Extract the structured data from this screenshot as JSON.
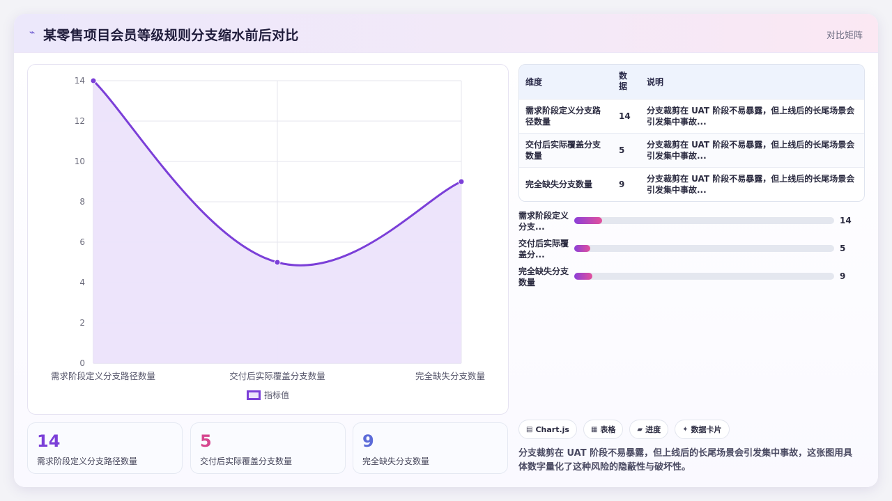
{
  "header": {
    "icon": "lightning-icon",
    "title": "某零售项目会员等级规则分支缩水前后对比",
    "tag": "对比矩阵"
  },
  "chart_data": {
    "type": "line",
    "categories": [
      "需求阶段定义分支路径数量",
      "交付后实际覆盖分支数量",
      "完全缺失分支数量"
    ],
    "series": [
      {
        "name": "指标值",
        "values": [
          14,
          5,
          9
        ]
      }
    ],
    "ylim": [
      0,
      14
    ],
    "yticks": [
      0,
      2,
      4,
      6,
      8,
      10,
      12,
      14
    ],
    "grid": true,
    "legend": "bottom",
    "line_color": "#7b3fd8",
    "fill_color": "#ece3fb"
  },
  "stats": [
    {
      "value": "14",
      "caption": "需求阶段定义分支路径数量",
      "color": "#7b3fd8"
    },
    {
      "value": "5",
      "caption": "交付后实际覆盖分支数量",
      "color": "#d6478f"
    },
    {
      "value": "9",
      "caption": "完全缺失分支数量",
      "color": "#5c6bd8"
    }
  ],
  "table": {
    "headers": [
      "维度",
      "数据",
      "说明"
    ],
    "rows": [
      {
        "dim": "需求阶段定义分支路径数量",
        "value": "14",
        "note": "分支裁剪在 UAT 阶段不易暴露，但上线后的长尾场景会引发集中事故..."
      },
      {
        "dim": "交付后实际覆盖分支数量",
        "value": "5",
        "note": "分支裁剪在 UAT 阶段不易暴露，但上线后的长尾场景会引发集中事故..."
      },
      {
        "dim": "完全缺失分支数量",
        "value": "9",
        "note": "分支裁剪在 UAT 阶段不易暴露，但上线后的长尾场景会引发集中事故..."
      }
    ]
  },
  "bars": [
    {
      "label": "需求阶段定义分支...",
      "value": 14,
      "display": "14",
      "fraction": 0.107
    },
    {
      "label": "交付后实际覆盖分...",
      "value": 5,
      "display": "5",
      "fraction": 0.062
    },
    {
      "label": "完全缺失分支数量",
      "value": 9,
      "display": "9",
      "fraction": 0.07
    }
  ],
  "chips": [
    {
      "icon": "chart-icon",
      "label": "Chart.js"
    },
    {
      "icon": "table-icon",
      "label": "表格"
    },
    {
      "icon": "progress-icon",
      "label": "进度"
    },
    {
      "icon": "sparkle-icon",
      "label": "数据卡片"
    }
  ],
  "description": "分支裁剪在 UAT 阶段不易暴露，但上线后的长尾场景会引发集中事故，这张图用具体数字量化了这种风险的隐蔽性与破坏性。"
}
